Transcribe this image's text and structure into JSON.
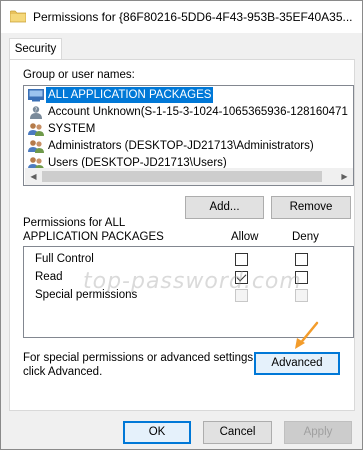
{
  "window": {
    "title": "Permissions for {86F80216-5DD6-4F43-953B-35EF40A35..."
  },
  "tabs": [
    {
      "label": "Security",
      "active": true
    }
  ],
  "group_section": {
    "label": "Group or user names:",
    "items": [
      {
        "label": "ALL APPLICATION PACKAGES",
        "icon": "app-packages-icon",
        "selected": true
      },
      {
        "label": "Account Unknown(S-1-15-3-1024-1065365936-128160471",
        "icon": "user-unknown-icon",
        "selected": false
      },
      {
        "label": "SYSTEM",
        "icon": "group-icon",
        "selected": false
      },
      {
        "label": "Administrators (DESKTOP-JD21713\\Administrators)",
        "icon": "group-icon",
        "selected": false
      },
      {
        "label": "Users (DESKTOP-JD21713\\Users)",
        "icon": "group-icon",
        "selected": false
      }
    ],
    "add_button": "Add...",
    "remove_button": "Remove"
  },
  "permissions": {
    "header_line1": "Permissions for ALL",
    "header_line2": "APPLICATION PACKAGES",
    "allow_label": "Allow",
    "deny_label": "Deny",
    "rows": [
      {
        "name": "Full Control",
        "allow": false,
        "deny": false,
        "disabled": false
      },
      {
        "name": "Read",
        "allow": true,
        "deny": false,
        "disabled": false
      },
      {
        "name": "Special permissions",
        "allow": false,
        "deny": false,
        "disabled": true
      }
    ]
  },
  "advanced": {
    "text_line1": "For special permissions or advanced settings,",
    "text_line2": "click Advanced.",
    "button": "Advanced"
  },
  "footer": {
    "ok": "OK",
    "cancel": "Cancel",
    "apply": "Apply"
  },
  "watermark": "top-password.com",
  "colors": {
    "selection": "#0078d7",
    "annotation_arrow": "#f39c2b"
  }
}
